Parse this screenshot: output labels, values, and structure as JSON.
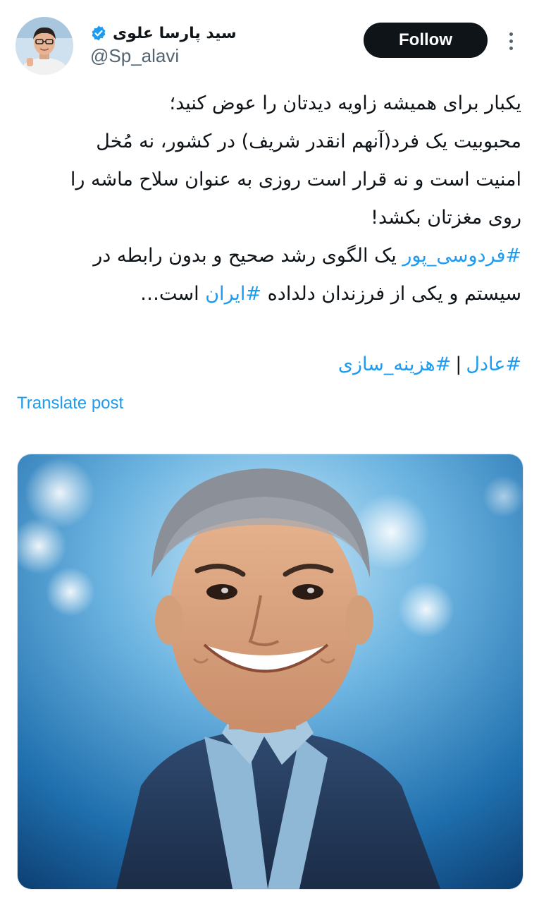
{
  "author": {
    "display_name": "سید پارسا علوی",
    "handle": "@Sp_alavi",
    "verified": true,
    "avatar_icon": "avatar-photo"
  },
  "header": {
    "follow_label": "Follow",
    "more_icon": "more-vertical-icon"
  },
  "tweet": {
    "line1": "یکبار برای همیشه زاویه دیدتان را عوض کنید؛",
    "line2": "محبوبیت یک فرد(آنهم انقدر شریف) در کشور، نه مُخل",
    "line3": "امنیت است و نه قرار است روزی به عنوان سلاح ماشه را",
    "line4": "روی مغزتان بکشد!",
    "line5_hashtag": "#فردوسی_پور",
    "line5_text": " یک الگوی رشد صحیح و بدون رابطه در",
    "line6_text_a": "سیستم و یکی از فرزندان دلداده ",
    "line6_hashtag": "#ایران",
    "line6_text_b": " است…",
    "hashtag1": "#عادل",
    "separator": "|",
    "hashtag2": "#هزینه_سازی"
  },
  "translate_label": "Translate post",
  "colors": {
    "link": "#1d9bf0",
    "text": "#0f1419",
    "secondary": "#536471",
    "button_bg": "#0f1419"
  }
}
